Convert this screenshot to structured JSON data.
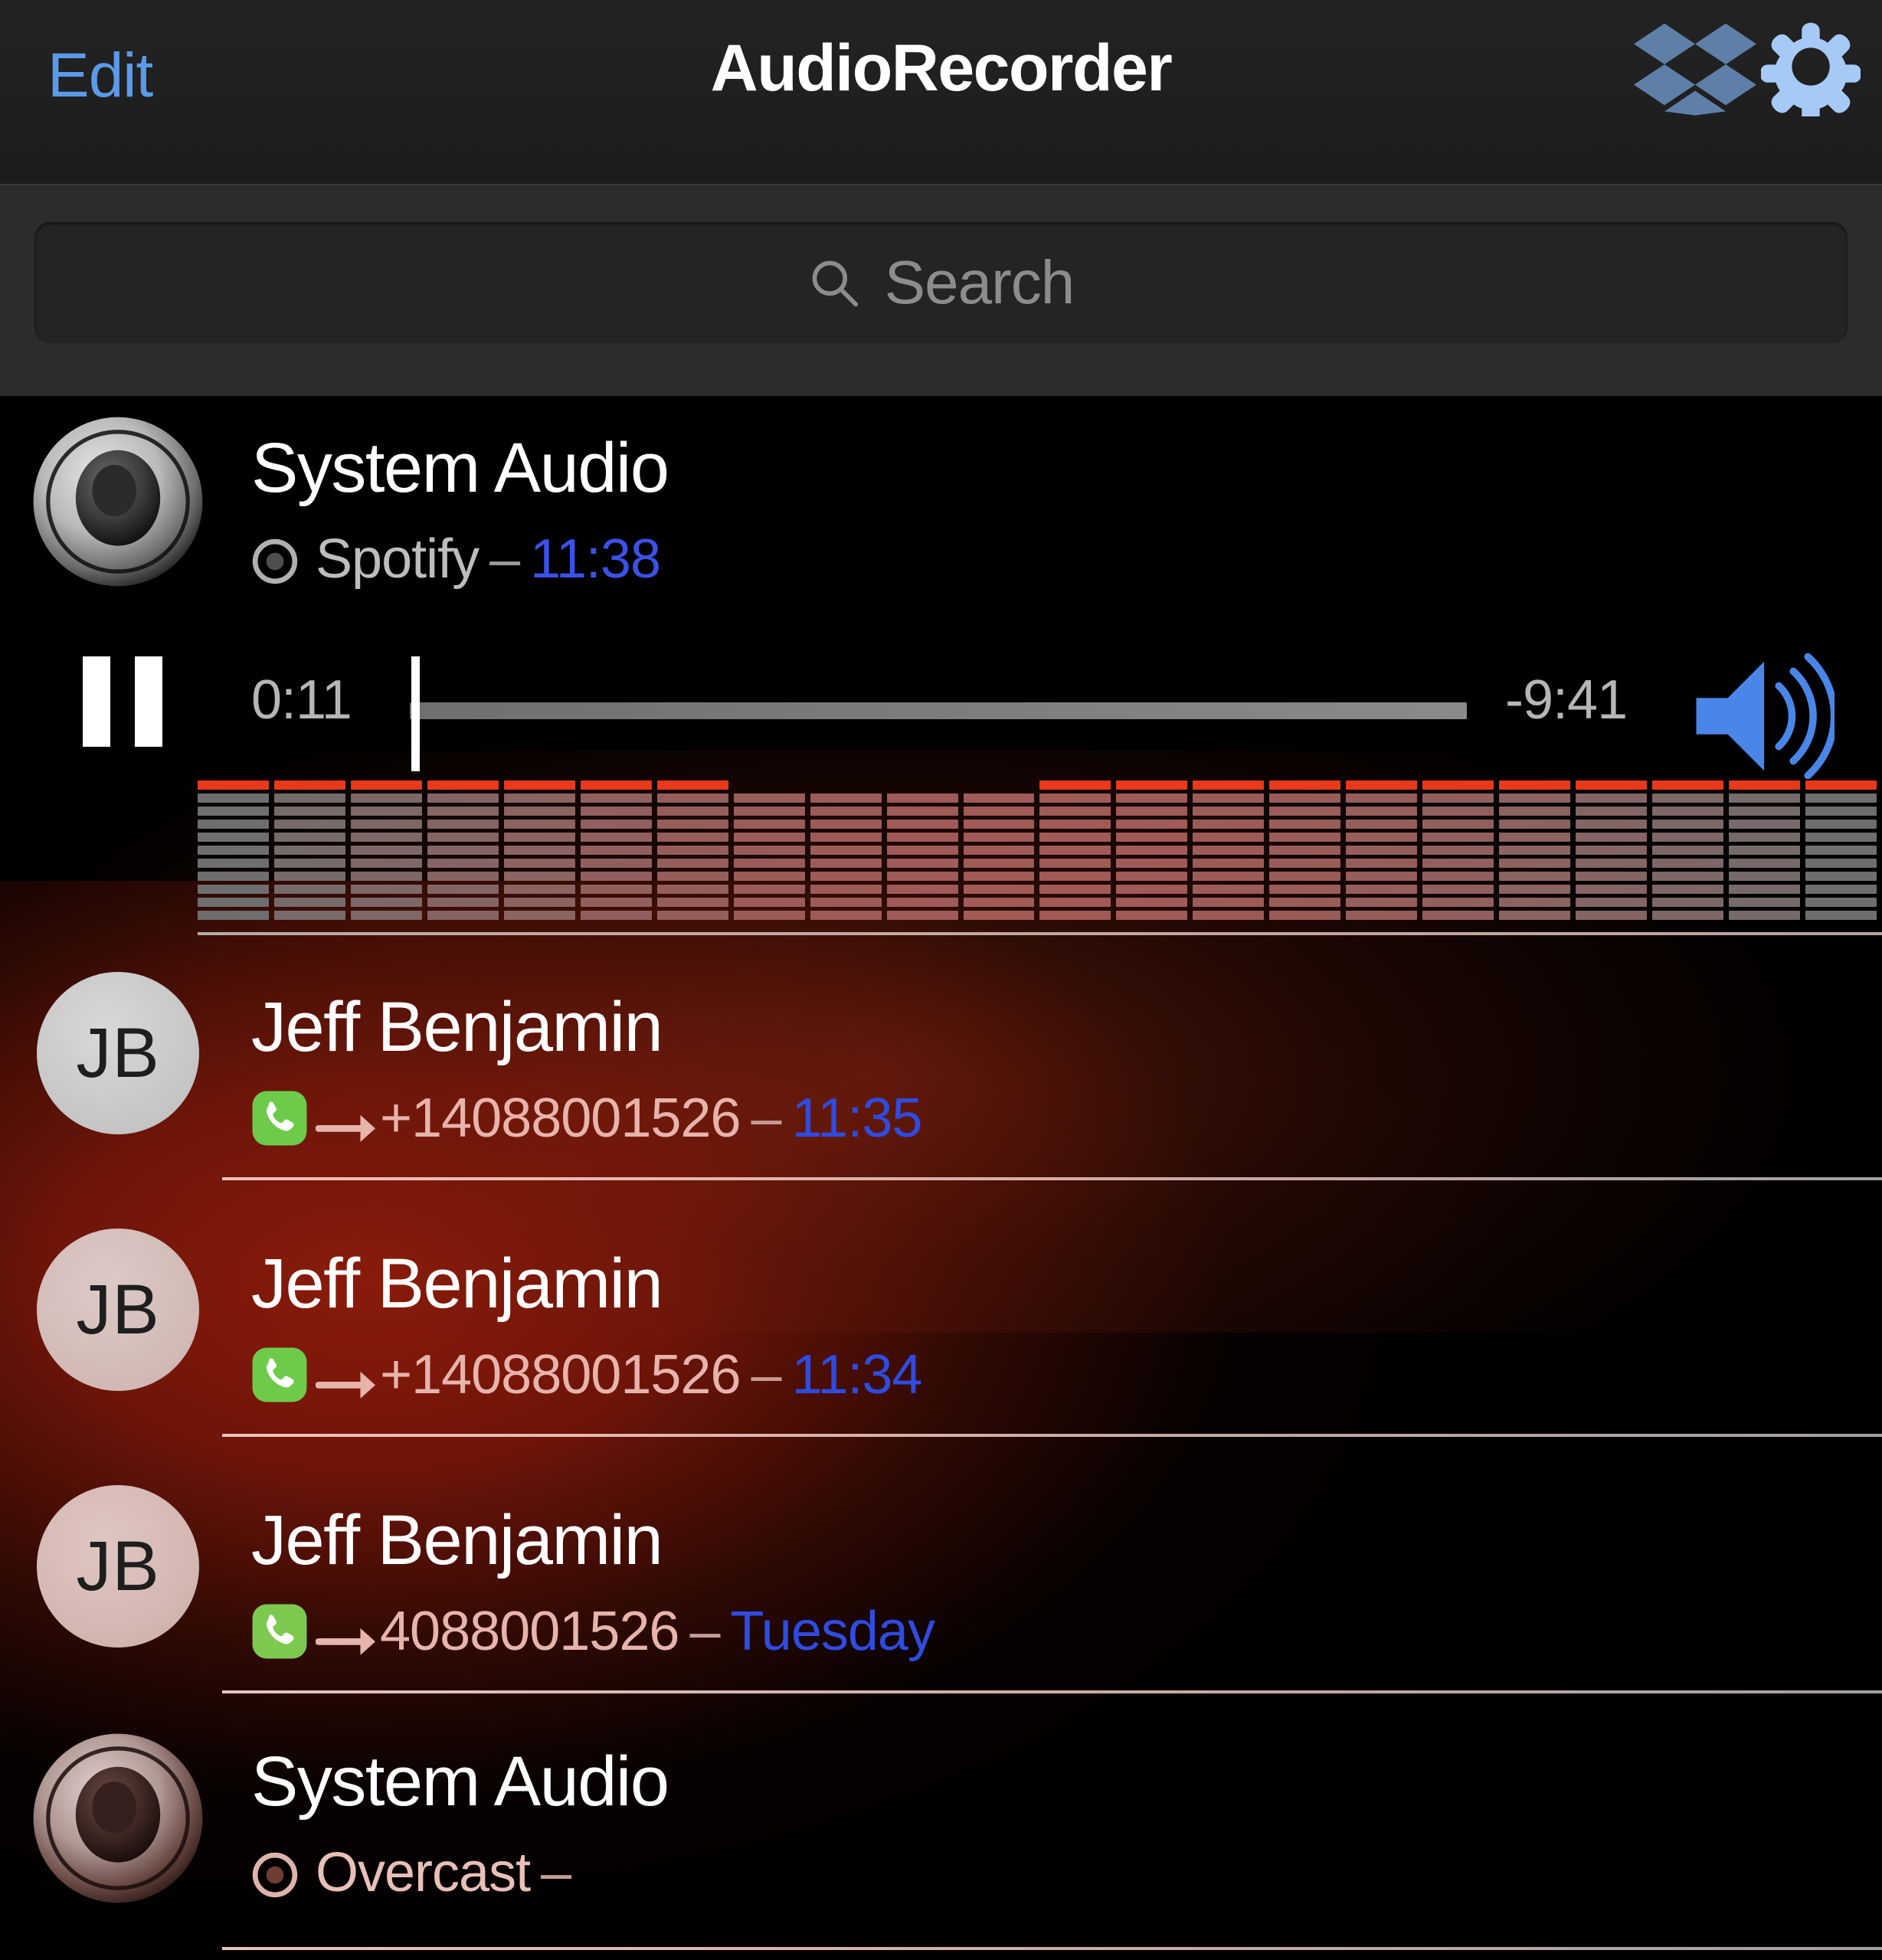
{
  "navbar": {
    "edit_label": "Edit",
    "title": "AudioRecorder",
    "dropbox_icon": "dropbox-icon",
    "gear_icon": "gear-icon",
    "edit_color": "#5b9ae8",
    "icon_color": "#9fc4f0"
  },
  "search": {
    "placeholder": "Search",
    "value": "",
    "icon": "search-icon"
  },
  "player": {
    "state_icon": "pause-icon",
    "elapsed": "0:11",
    "remaining": "-9:41",
    "volume_icon": "volume-high-icon",
    "progress_percent": 1.8,
    "accent_color": "#e8391a"
  },
  "equalizer": {
    "columns": 22,
    "segments_per_column": 11,
    "peak_on": [
      true,
      true,
      true,
      true,
      true,
      true,
      true,
      false,
      false,
      false,
      false,
      true,
      true,
      true,
      true,
      true,
      true,
      true,
      true,
      true,
      true,
      true
    ]
  },
  "recordings": [
    {
      "id": "rec-1",
      "avatar_type": "speaker",
      "avatar_variant": "gray",
      "title": "System Audio",
      "source_icon": "record-dot-icon",
      "source": "Spotify",
      "separator": "–",
      "timestamp": "11:38",
      "expanded": true
    },
    {
      "id": "rec-2",
      "avatar_type": "initials",
      "avatar_variant": "gray",
      "initials": "JB",
      "title": "Jeff Benjamin",
      "source_icon": "phone-icon",
      "direction_icon": "arrow-right-icon",
      "source": "+14088001526",
      "separator": "–",
      "timestamp": "11:35",
      "expanded": false
    },
    {
      "id": "rec-3",
      "avatar_type": "initials",
      "avatar_variant": "pink1",
      "initials": "JB",
      "title": "Jeff Benjamin",
      "source_icon": "phone-icon",
      "direction_icon": "arrow-right-icon",
      "source": "+14088001526",
      "separator": "–",
      "timestamp": "11:34",
      "expanded": false
    },
    {
      "id": "rec-4",
      "avatar_type": "initials",
      "avatar_variant": "pink2",
      "initials": "JB",
      "title": "Jeff Benjamin",
      "source_icon": "phone-icon",
      "direction_icon": "arrow-right-icon",
      "source": "4088001526",
      "separator": "–",
      "timestamp": "Tuesday",
      "expanded": false
    },
    {
      "id": "rec-5",
      "avatar_type": "speaker",
      "avatar_variant": "red",
      "title": "System Audio",
      "source_icon": "record-dot-icon",
      "source": "Overcast",
      "separator": "–",
      "timestamp": "",
      "expanded": false
    }
  ]
}
